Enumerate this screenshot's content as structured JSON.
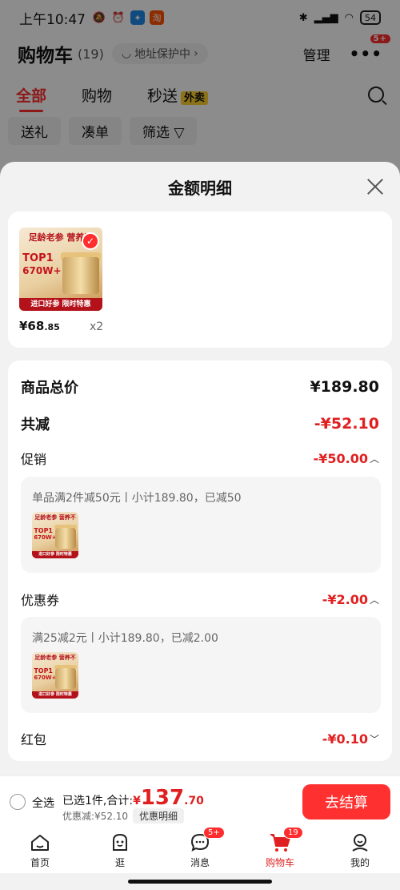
{
  "status_bar": {
    "time": "上午10:47",
    "battery": "54"
  },
  "cart": {
    "title": "购物车",
    "count": "(19)",
    "address_pill": "地址保护中",
    "manage": "管理",
    "more_badge": "5+",
    "tabs": [
      {
        "label": "全部"
      },
      {
        "label": "购物"
      },
      {
        "label": "秒送",
        "tag": "外卖"
      }
    ],
    "chips": [
      "送礼",
      "凑单",
      "筛选"
    ]
  },
  "sheet": {
    "title": "金额明细",
    "product": {
      "image_header": "足龄老参 营养不",
      "image_top1": "TOP1",
      "image_sales": "670W+",
      "image_footer": "进口好参 限时特惠",
      "price_int": "¥68",
      "price_dec": ".85",
      "qty": "x2"
    },
    "rows": {
      "total_label": "商品总价",
      "total_value": "¥189.80",
      "reduce_label": "共减",
      "reduce_value": "-¥52.10",
      "promo_label": "促销",
      "promo_value": "-¥50.00",
      "promo_desc": "单品满2件减50元丨小计189.80，已减50",
      "coupon_label": "优惠券",
      "coupon_value": "-¥2.00",
      "coupon_desc": "满25减2元丨小计189.80，已减2.00",
      "redpack_label": "红包",
      "redpack_value": "-¥0.10"
    }
  },
  "checkout": {
    "select_all": "全选",
    "selected_text": "已选1件,合计:",
    "total_currency": "¥",
    "total_int": "137",
    "total_dec": ".70",
    "discount_text": "优惠减:¥52.10",
    "detail_label": "优惠明细",
    "pay_label": "去结算"
  },
  "tabbar": [
    {
      "label": "首页",
      "icon": "home-icon"
    },
    {
      "label": "逛",
      "icon": "browse-icon"
    },
    {
      "label": "消息",
      "icon": "message-icon",
      "badge": "5+"
    },
    {
      "label": "购物车",
      "icon": "cart-icon",
      "badge": "19",
      "active": true
    },
    {
      "label": "我的",
      "icon": "profile-icon"
    }
  ],
  "colors": {
    "accent": "#ff2d2d",
    "price_red": "#e02020",
    "sheet_bg": "#f2f2f2"
  }
}
